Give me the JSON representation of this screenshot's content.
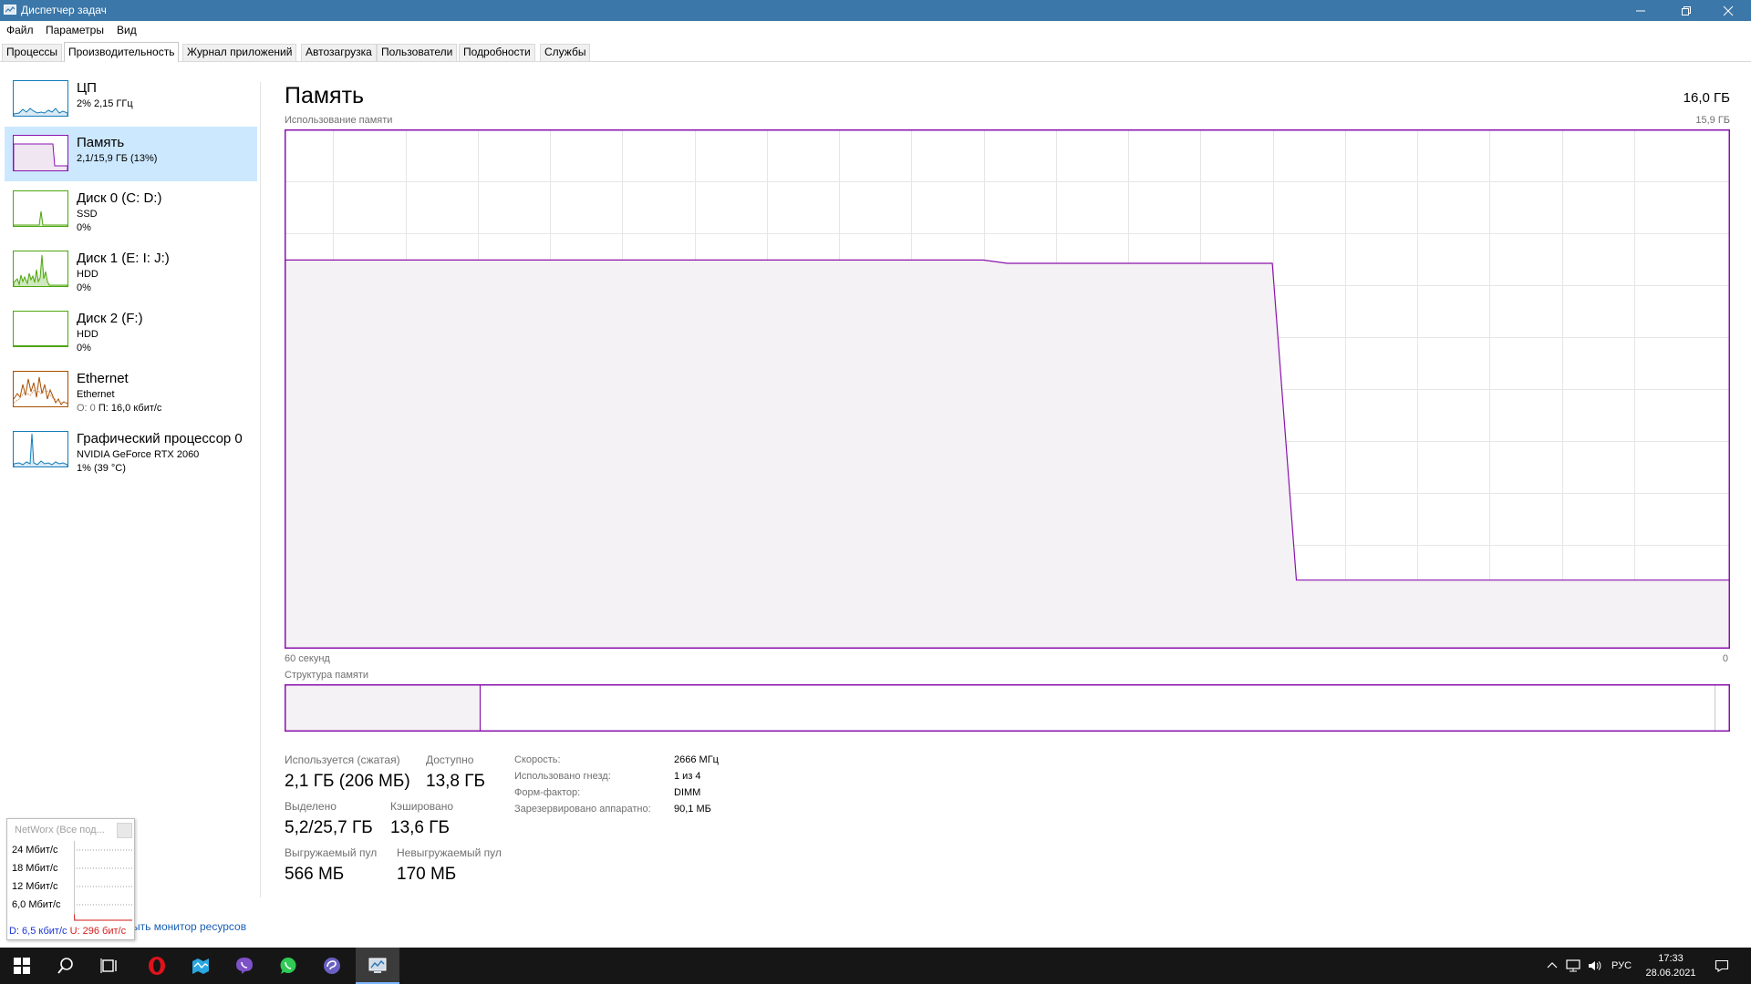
{
  "window": {
    "title": "Диспетчер задач"
  },
  "menu": [
    "Файл",
    "Параметры",
    "Вид"
  ],
  "tabs": [
    {
      "label": "Процессы",
      "active": false
    },
    {
      "label": "Производительность",
      "active": true
    },
    {
      "label": "Журнал приложений",
      "active": false
    },
    {
      "label": "Автозагрузка",
      "active": false
    },
    {
      "label": "Пользователи",
      "active": false
    },
    {
      "label": "Подробности",
      "active": false
    },
    {
      "label": "Службы",
      "active": false
    }
  ],
  "sidebar": {
    "items": [
      {
        "title": "ЦП",
        "line1": "2% 2,15 ГГц",
        "line2": "",
        "color": "#117dbb",
        "selected": false
      },
      {
        "title": "Память",
        "line1": "2,1/15,9 ГБ (13%)",
        "line2": "",
        "color": "#8b12ae",
        "selected": true
      },
      {
        "title": "Диск 0 (C: D:)",
        "line1": "SSD",
        "line2": "0%",
        "color": "#4da60c",
        "selected": false
      },
      {
        "title": "Диск 1 (E: I: J:)",
        "line1": "HDD",
        "line2": "0%",
        "color": "#4da60c",
        "selected": false
      },
      {
        "title": "Диск 2 (F:)",
        "line1": "HDD",
        "line2": "0%",
        "color": "#4da60c",
        "selected": false
      },
      {
        "title": "Ethernet",
        "line1": "Ethernet",
        "line2_sent": "О: 0",
        "line2_recv": "П: 16,0 кбит/с",
        "color": "#a74f01",
        "selected": false
      },
      {
        "title": "Графический процессор 0",
        "line1": "NVIDIA GeForce RTX 2060",
        "line2": "1% (39 °C)",
        "color": "#117dbb",
        "selected": false
      }
    ]
  },
  "main": {
    "title": "Память",
    "total": "16,0 ГБ",
    "graph_label": "Использование памяти",
    "graph_max": "15,9 ГБ",
    "time_left": "60 секунд",
    "time_right": "0",
    "struct_label": "Структура памяти",
    "accent": "#8b12ae",
    "fill": "#f4f2f4",
    "usage_series": {
      "unit": "ГБ",
      "max": 15.9,
      "values": [
        11.9,
        11.9,
        11.9,
        11.9,
        11.9,
        11.9,
        11.9,
        11.9,
        11.9,
        11.9,
        11.9,
        11.9,
        11.9,
        11.9,
        11.9,
        11.9,
        11.9,
        11.9,
        11.9,
        11.9,
        11.9,
        11.9,
        11.9,
        11.9,
        11.9,
        11.9,
        11.9,
        11.9,
        11.9,
        11.9,
        11.8,
        11.8,
        11.8,
        11.8,
        11.8,
        11.8,
        11.8,
        11.8,
        11.8,
        11.8,
        11.8,
        11.8,
        2.1,
        2.1,
        2.1,
        2.1,
        2.1,
        2.1,
        2.1,
        2.1,
        2.1,
        2.1,
        2.1,
        2.1,
        2.1,
        2.1,
        2.1,
        2.1,
        2.1,
        2.1,
        2.1
      ]
    },
    "structure": {
      "in_use_fraction": 0.135,
      "reserved_fraction": 0.011
    },
    "stats": {
      "in_use_label": "Используется (сжатая)",
      "in_use_value": "2,1 ГБ (206 МБ)",
      "available_label": "Доступно",
      "available_value": "13,8 ГБ",
      "committed_label": "Выделено",
      "committed_value": "5,2/25,7 ГБ",
      "cached_label": "Кэшировано",
      "cached_value": "13,6 ГБ",
      "paged_label": "Выгружаемый пул",
      "paged_value": "566 МБ",
      "nonpaged_label": "Невыгружаемый пул",
      "nonpaged_value": "170 МБ"
    },
    "specs": [
      {
        "label": "Скорость:",
        "value": "2666 МГц"
      },
      {
        "label": "Использовано гнезд:",
        "value": "1 из 4"
      },
      {
        "label": "Форм-фактор:",
        "value": "DIMM"
      },
      {
        "label": "Зарезервировано аппаратно:",
        "value": "90,1 МБ"
      }
    ]
  },
  "resmon_link": "ыть монитор ресурсов",
  "networx": {
    "title": "NetWorx (Все под...",
    "scale": [
      "24 Мбит/с",
      "18 Мбит/с",
      "12 Мбит/с",
      "6,0 Мбит/с"
    ],
    "down": "D: 6,5 кбит/с",
    "up": "U: 296 бит/с",
    "down_color": "#1a33d6",
    "up_color": "#d61a1a"
  },
  "taskbar": {
    "lang": "РУС",
    "time": "17:33",
    "date": "28.06.2021",
    "apps": [
      "windows-start-icon",
      "search-icon",
      "task-view-icon",
      "opera-icon",
      "maps-icon",
      "viber-icon",
      "whatsapp-icon",
      "bittorrent-icon",
      "task-manager-icon"
    ]
  }
}
